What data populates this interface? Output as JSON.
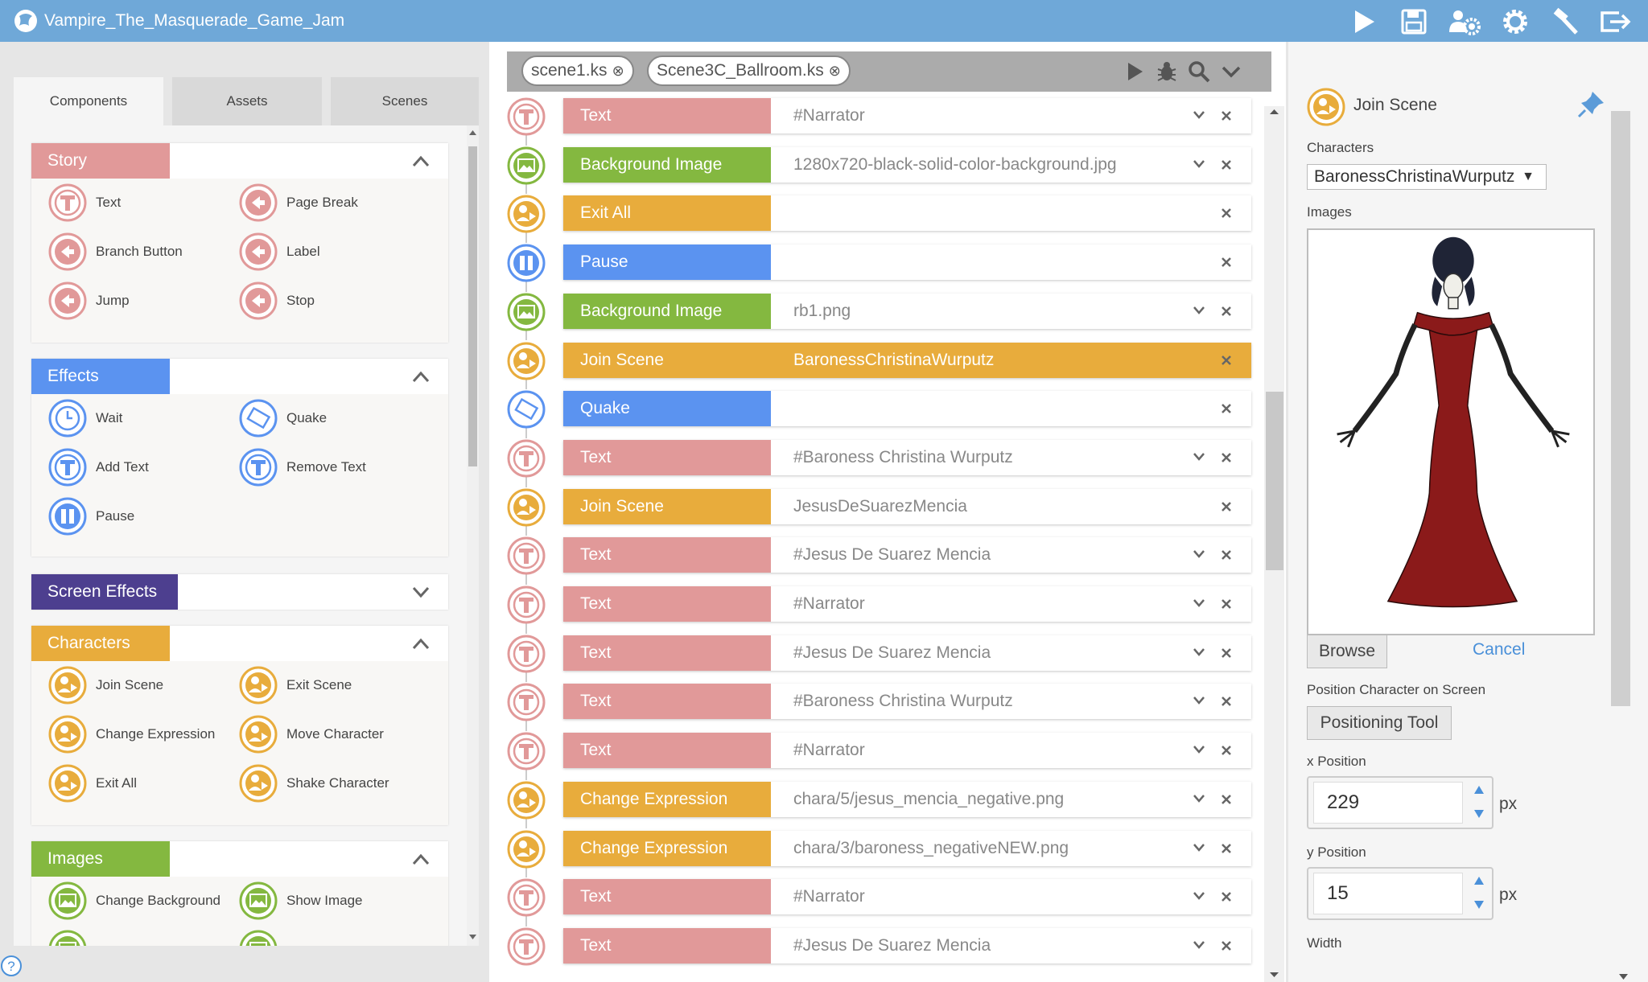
{
  "app": {
    "title": "Vampire_The_Masquerade_Game_Jam"
  },
  "toolbar": {
    "icons": [
      "play-icon",
      "save-icon",
      "users-gear-icon",
      "gear-icon",
      "hammer-icon",
      "exit-icon"
    ]
  },
  "left_panel": {
    "tabs": [
      {
        "label": "Components"
      },
      {
        "label": "Assets"
      },
      {
        "label": "Scenes"
      }
    ],
    "groups": {
      "story": {
        "title": "Story",
        "color": "#e19999",
        "items": [
          {
            "label": "Text"
          },
          {
            "label": "Page Break"
          },
          {
            "label": "Branch Button"
          },
          {
            "label": "Label"
          },
          {
            "label": "Jump"
          },
          {
            "label": "Stop"
          }
        ]
      },
      "effects": {
        "title": "Effects",
        "color": "#5b93f0",
        "items": [
          {
            "label": "Wait"
          },
          {
            "label": "Quake"
          },
          {
            "label": "Add Text"
          },
          {
            "label": "Remove Text"
          },
          {
            "label": "Pause"
          }
        ]
      },
      "screen_effects": {
        "title": "Screen Effects",
        "color": "#4d3f8f"
      },
      "characters": {
        "title": "Characters",
        "color": "#e8ac3c",
        "items": [
          {
            "label": "Join Scene"
          },
          {
            "label": "Exit Scene"
          },
          {
            "label": "Change Expression"
          },
          {
            "label": "Move Character"
          },
          {
            "label": "Exit All"
          },
          {
            "label": "Shake Character"
          }
        ]
      },
      "images": {
        "title": "Images",
        "color": "#84b840",
        "items": [
          {
            "label": "Change Background"
          },
          {
            "label": "Show Image"
          }
        ]
      }
    }
  },
  "editor": {
    "tabs": [
      {
        "label": "scene1.ks"
      },
      {
        "label": "Scene3C_Ballroom.ks"
      }
    ],
    "rows": [
      {
        "label": "Text",
        "value": "#Narrator",
        "color": "#e19999",
        "icon": "text-icon",
        "chev": true
      },
      {
        "label": "Background Image",
        "value": "1280x720-black-solid-color-background.jpg",
        "color": "#84b840",
        "icon": "image-icon",
        "chev": true
      },
      {
        "label": "Exit All",
        "value": "",
        "color": "#e8ac3c",
        "icon": "exit-all-icon",
        "chev": false
      },
      {
        "label": "Pause",
        "value": "",
        "color": "#5b93f0",
        "icon": "pause-icon",
        "chev": false
      },
      {
        "label": "Background Image",
        "value": "rb1.png",
        "color": "#84b840",
        "icon": "image-icon",
        "chev": true
      },
      {
        "label": "Join Scene",
        "value": "BaronessChristinaWurputz",
        "color": "#e8ac3c",
        "icon": "join-scene-icon",
        "chev": false,
        "selected": true
      },
      {
        "label": "Quake",
        "value": "",
        "color": "#5b93f0",
        "icon": "quake-icon",
        "chev": false
      },
      {
        "label": "Text",
        "value": "#Baroness Christina Wurputz",
        "color": "#e19999",
        "icon": "text-icon",
        "chev": true
      },
      {
        "label": "Join Scene",
        "value": "JesusDeSuarezMencia",
        "color": "#e8ac3c",
        "icon": "join-scene-icon",
        "chev": false
      },
      {
        "label": "Text",
        "value": "#Jesus De Suarez Mencia",
        "color": "#e19999",
        "icon": "text-icon",
        "chev": true
      },
      {
        "label": "Text",
        "value": "#Narrator",
        "color": "#e19999",
        "icon": "text-icon",
        "chev": true
      },
      {
        "label": "Text",
        "value": "#Jesus De Suarez Mencia",
        "color": "#e19999",
        "icon": "text-icon",
        "chev": true
      },
      {
        "label": "Text",
        "value": "#Baroness Christina Wurputz",
        "color": "#e19999",
        "icon": "text-icon",
        "chev": true
      },
      {
        "label": "Text",
        "value": "#Narrator",
        "color": "#e19999",
        "icon": "text-icon",
        "chev": true
      },
      {
        "label": "Change Expression",
        "value": "chara/5/jesus_mencia_negative.png",
        "color": "#e8ac3c",
        "icon": "change-expression-icon",
        "chev": true
      },
      {
        "label": "Change Expression",
        "value": "chara/3/baroness_negativeNEW.png",
        "color": "#e8ac3c",
        "icon": "change-expression-icon",
        "chev": true
      },
      {
        "label": "Text",
        "value": "#Narrator",
        "color": "#e19999",
        "icon": "text-icon",
        "chev": true
      },
      {
        "label": "Text",
        "value": "#Jesus De Suarez Mencia",
        "color": "#e19999",
        "icon": "text-icon",
        "chev": true
      }
    ]
  },
  "properties": {
    "title": "Join Scene",
    "characters_label": "Characters",
    "character_selected": "BaronessChristinaWurputz",
    "images_label": "Images",
    "browse": "Browse",
    "cancel": "Cancel",
    "position_label": "Position Character on Screen",
    "positioning_tool": "Positioning Tool",
    "x_label": "x Position",
    "x_value": "229",
    "y_label": "y Position",
    "y_value": "15",
    "unit": "px",
    "width_label": "Width"
  }
}
